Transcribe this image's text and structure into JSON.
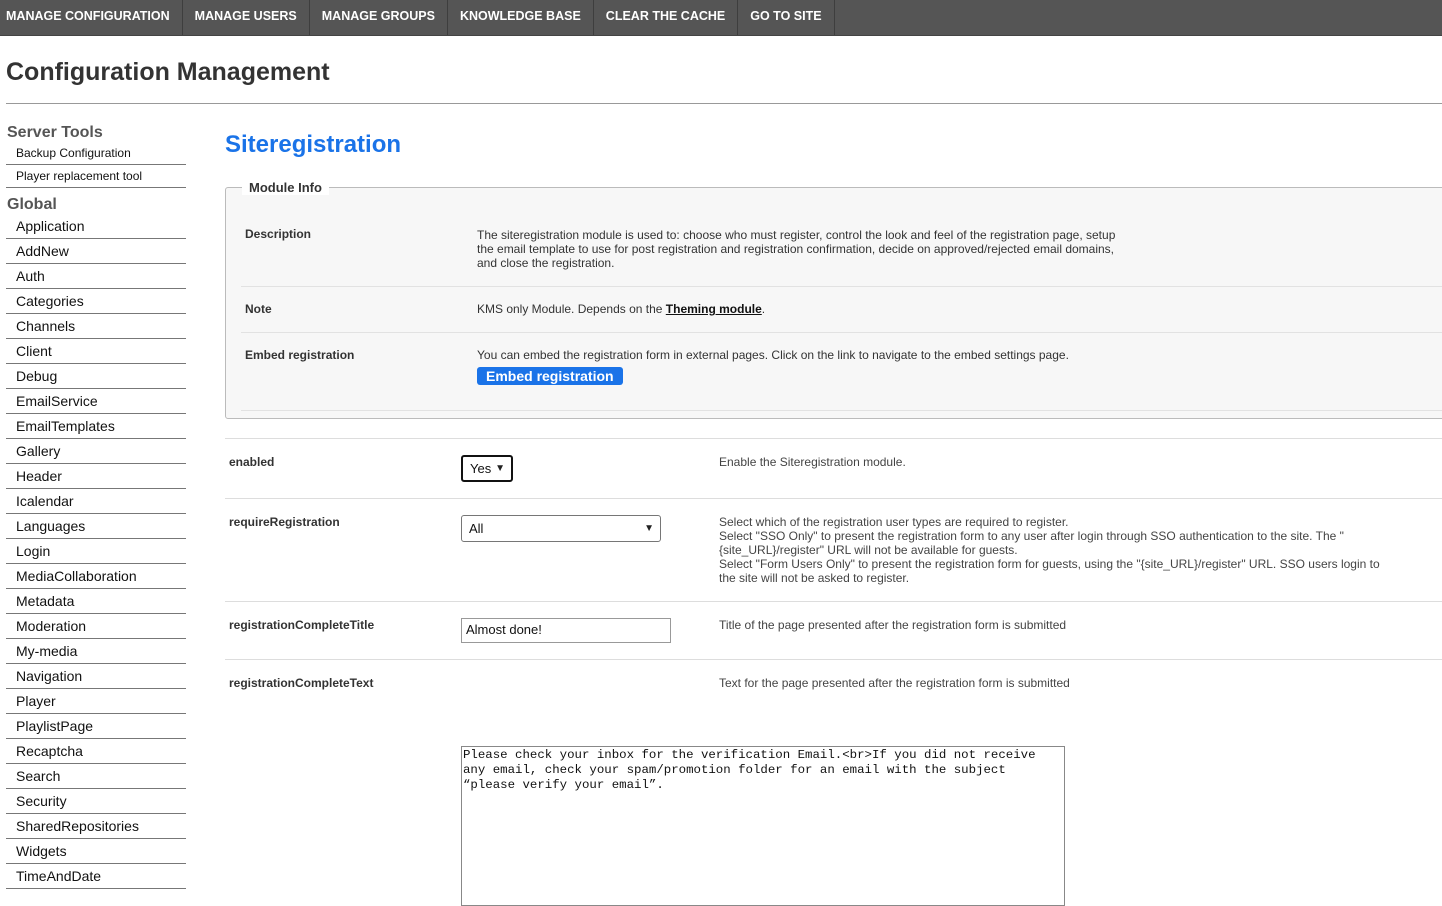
{
  "topnav": {
    "items": [
      {
        "label": "MANAGE CONFIGURATION"
      },
      {
        "label": "MANAGE USERS"
      },
      {
        "label": "MANAGE GROUPS"
      },
      {
        "label": "KNOWLEDGE BASE"
      },
      {
        "label": "CLEAR THE CACHE"
      },
      {
        "label": "GO TO SITE"
      }
    ]
  },
  "page": {
    "title": "Configuration Management"
  },
  "sidebar": {
    "server_tools_heading": "Server Tools",
    "server_tools": [
      {
        "label": "Backup Configuration"
      },
      {
        "label": "Player replacement tool"
      }
    ],
    "global_heading": "Global",
    "global_items": [
      {
        "label": "Application"
      },
      {
        "label": "AddNew"
      },
      {
        "label": "Auth"
      },
      {
        "label": "Categories"
      },
      {
        "label": "Channels"
      },
      {
        "label": "Client"
      },
      {
        "label": "Debug"
      },
      {
        "label": "EmailService"
      },
      {
        "label": "EmailTemplates"
      },
      {
        "label": "Gallery"
      },
      {
        "label": "Header"
      },
      {
        "label": "Icalendar"
      },
      {
        "label": "Languages"
      },
      {
        "label": "Login"
      },
      {
        "label": "MediaCollaboration"
      },
      {
        "label": "Metadata"
      },
      {
        "label": "Moderation"
      },
      {
        "label": "My-media"
      },
      {
        "label": "Navigation"
      },
      {
        "label": "Player"
      },
      {
        "label": "PlaylistPage"
      },
      {
        "label": "Recaptcha"
      },
      {
        "label": "Search"
      },
      {
        "label": "Security"
      },
      {
        "label": "SharedRepositories"
      },
      {
        "label": "Widgets"
      },
      {
        "label": "TimeAndDate"
      }
    ]
  },
  "module": {
    "title": "Siteregistration",
    "info_legend": "Module Info",
    "description_label": "Description",
    "description_text": "The siteregistration module is used to: choose who must register, control the look and feel of the registration page, setup the email template to use for post registration and registration confirmation, decide on approved/rejected email domains, and close the registration.",
    "note_label": "Note",
    "note_prefix": "KMS only Module. Depends on the ",
    "note_link": "Theming module",
    "note_suffix": ".",
    "embed_label": "Embed registration",
    "embed_text": "You can embed the registration form in external pages. Click on the link to navigate to the embed settings page.",
    "embed_button": "Embed registration"
  },
  "settings": {
    "enabled": {
      "name": "enabled",
      "value": "Yes",
      "description": "Enable the Siteregistration module."
    },
    "requireRegistration": {
      "name": "requireRegistration",
      "value": "All",
      "description_lines": [
        "Select which of the registration user types are required to register.",
        "Select \"SSO Only\" to present the registration form to any user after login through SSO authentication to the site. The \"{site_URL}/register\" URL will not be available for guests.",
        "Select \"Form Users Only\" to present the registration form for guests, using the \"{site_URL}/register\" URL. SSO users login to the site will not be asked to register."
      ]
    },
    "registrationCompleteTitle": {
      "name": "registrationCompleteTitle",
      "value": "Almost done!",
      "description": "Title of the page presented after the registration form is submitted"
    },
    "registrationCompleteText": {
      "name": "registrationCompleteText",
      "value": "Please check your inbox for the verification Email.<br>If you did not receive any email, check your spam/promotion folder for an email with the subject “please verify your email”.",
      "description": "Text for the page presented after the registration form is submitted"
    }
  }
}
